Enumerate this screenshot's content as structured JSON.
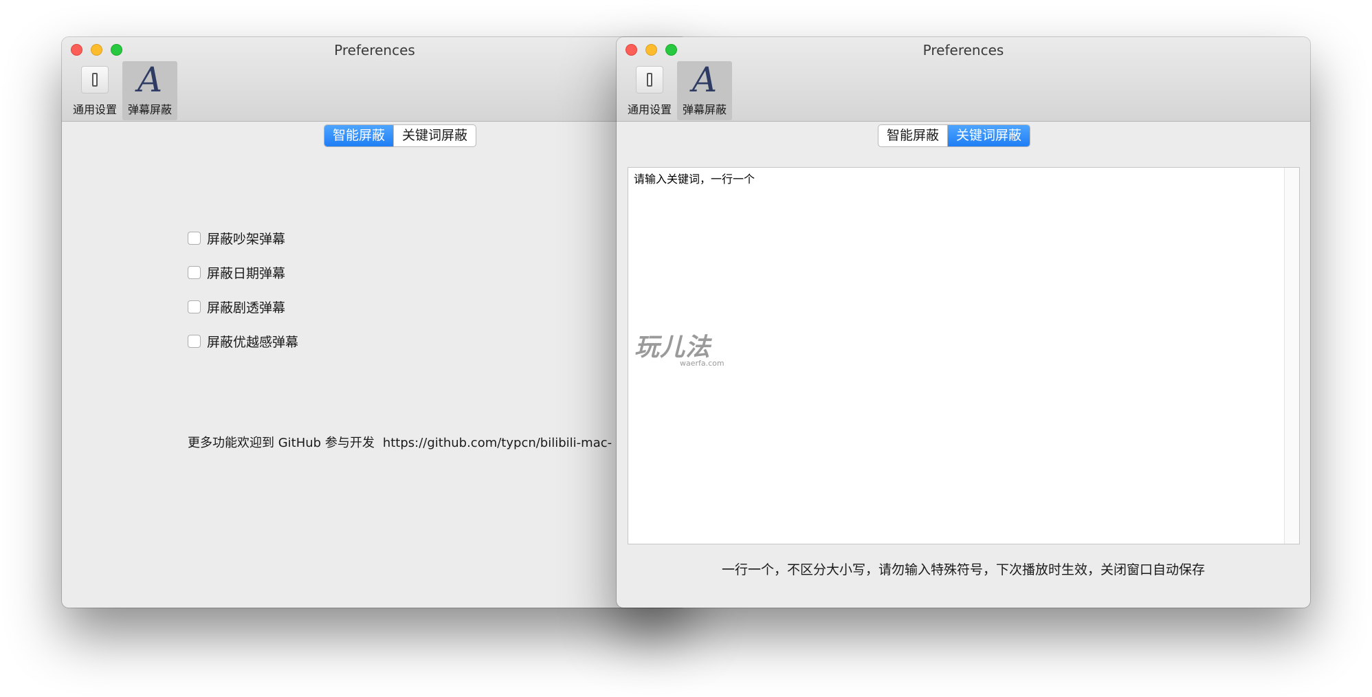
{
  "left_window": {
    "title": "Preferences",
    "toolbar": [
      {
        "label": "通用设置",
        "icon": "switch-icon"
      },
      {
        "label": "弹幕屏蔽",
        "icon": "font-icon"
      }
    ],
    "icon_letter": "A",
    "segments": [
      "智能屏蔽",
      "关键词屏蔽"
    ],
    "active_segment": "智能屏蔽",
    "checkboxes": [
      {
        "label": "屏蔽吵架弹幕",
        "checked": false
      },
      {
        "label": "屏蔽日期弹幕",
        "checked": false
      },
      {
        "label": "屏蔽剧透弹幕",
        "checked": false
      },
      {
        "label": "屏蔽优越感弹幕",
        "checked": false
      }
    ],
    "footer_text": "更多功能欢迎到 GitHub 参与开发",
    "footer_link": "https://github.com/typcn/bilibili-mac-"
  },
  "right_window": {
    "title": "Preferences",
    "toolbar": [
      {
        "label": "通用设置",
        "icon": "switch-icon"
      },
      {
        "label": "弹幕屏蔽",
        "icon": "font-icon"
      }
    ],
    "icon_letter": "A",
    "segments": [
      "智能屏蔽",
      "关键词屏蔽"
    ],
    "active_segment": "关键词屏蔽",
    "textarea_value": "请输入关键词，一行一个",
    "hint": "一行一个，不区分大小写，请勿输入特殊符号，下次播放时生效，关闭窗口自动保存"
  },
  "watermark": {
    "logo": "玩儿法",
    "url": "waerfa.com"
  },
  "colors": {
    "accent": "#1f7ef5",
    "window_bg": "#ececec"
  }
}
